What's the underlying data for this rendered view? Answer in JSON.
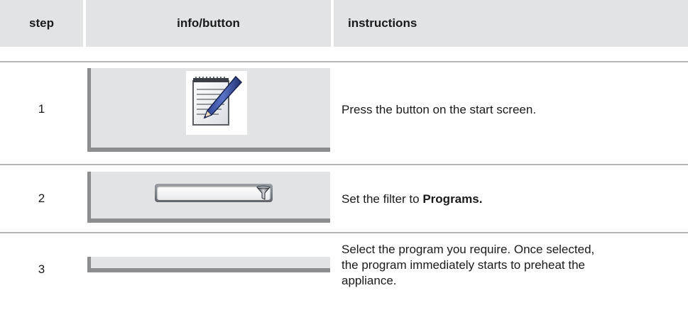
{
  "header": {
    "step": "step",
    "info": "info/button",
    "instructions": "instructions"
  },
  "rows": [
    {
      "step": "1",
      "icon": "notepad-pencil-icon",
      "text": "Press the button on the start screen."
    },
    {
      "step": "2",
      "icon": "filter-funnel-icon",
      "text_before": "Set the filter to ",
      "text_bold": "Programs."
    },
    {
      "step": "3",
      "text_lines": [
        "Select the program you require. Once selected,",
        "the program immediately starts to preheat the",
        "appliance."
      ]
    }
  ],
  "colors": {
    "header_bg": "#e2e3e5",
    "panel_shadow": "#8c8d8f",
    "rule": "#b5b6b8"
  }
}
